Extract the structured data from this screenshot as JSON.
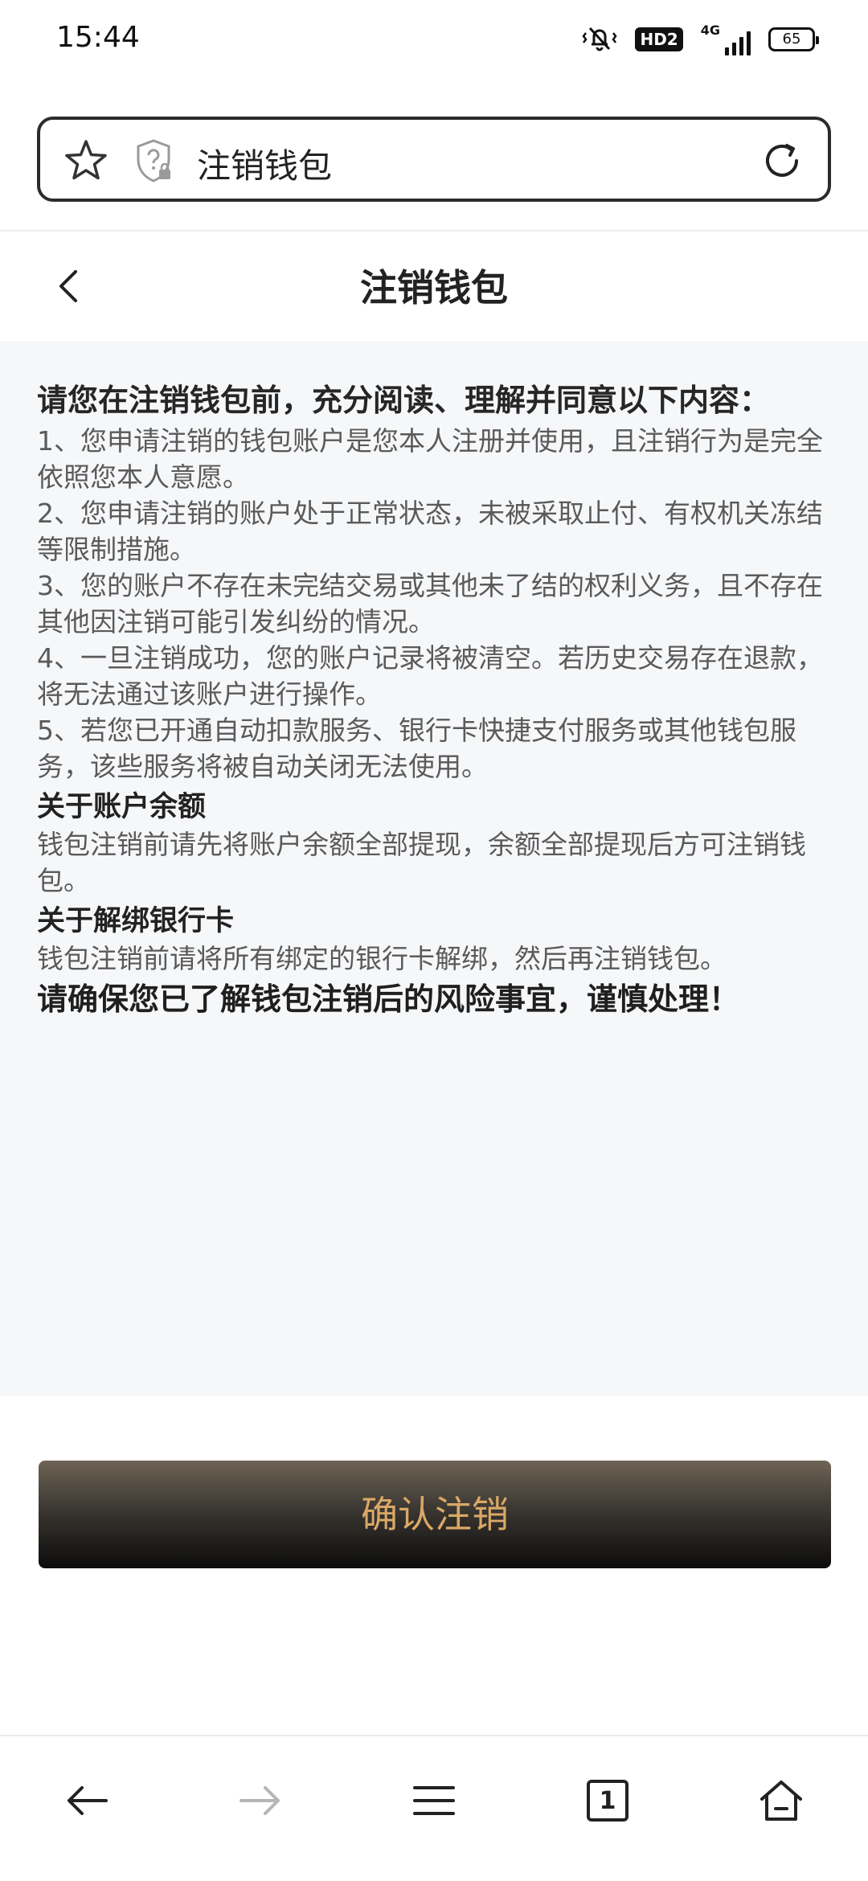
{
  "status_bar": {
    "time": "15:44",
    "hd_label": "HD2",
    "network_label": "4G",
    "battery": "65"
  },
  "address_bar": {
    "title": "注销钱包"
  },
  "header": {
    "title": "注销钱包"
  },
  "content": {
    "intro": "请您在注销钱包前，充分阅读、理解并同意以下内容：",
    "clauses": [
      "1、您申请注销的钱包账户是您本人注册并使用，且注销行为是完全依照您本人意愿。",
      "2、您申请注销的账户处于正常状态，未被采取止付、有权机关冻结等限制措施。",
      "3、您的账户不存在未完结交易或其他未了结的权利义务，且不存在其他因注销可能引发纠纷的情况。",
      "4、一旦注销成功，您的账户记录将被清空。若历史交易存在退款，将无法通过该账户进行操作。",
      "5、若您已开通自动扣款服务、银行卡快捷支付服务或其他钱包服务，该些服务将被自动关闭无法使用。"
    ],
    "balance_head": "关于账户余额",
    "balance_text": "钱包注销前请先将账户余额全部提现，余额全部提现后方可注销钱包。",
    "card_head": "关于解绑银行卡",
    "card_text": "钱包注销前请将所有绑定的银行卡解绑，然后再注销钱包。",
    "warning": "请确保您已了解钱包注销后的风险事宜，谨慎处理！"
  },
  "confirm_button": {
    "label": "确认注销"
  },
  "bottom_nav": {
    "tab_count": "1",
    "items": [
      "back-icon",
      "forward-icon",
      "menu-icon",
      "tabs-icon",
      "home-icon"
    ]
  },
  "colors": {
    "content_bg": "#f6f7f9",
    "button_text": "#d9a866",
    "button_dark": "#0c0c0c"
  }
}
